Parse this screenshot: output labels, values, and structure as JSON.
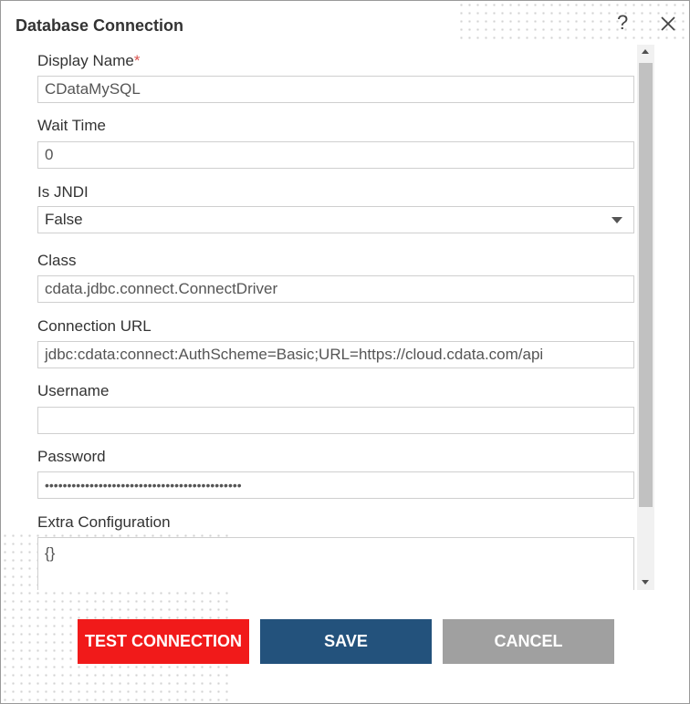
{
  "dialog": {
    "title": "Database Connection",
    "help_icon": "?",
    "close_icon": "close-icon"
  },
  "form": {
    "display_name": {
      "label": "Display Name",
      "required_mark": "*",
      "value": "CDataMySQL"
    },
    "wait_time": {
      "label": "Wait Time",
      "value": "0"
    },
    "is_jndi": {
      "label": "Is JNDI",
      "selected": "False"
    },
    "class": {
      "label": "Class",
      "value": "cdata.jdbc.connect.ConnectDriver"
    },
    "connection_url": {
      "label": "Connection URL",
      "value": "jdbc:cdata:connect:AuthScheme=Basic;URL=https://cloud.cdata.com/api"
    },
    "username": {
      "label": "Username",
      "value": ""
    },
    "password": {
      "label": "Password",
      "value": "••••••••••••••••••••••••••••••••••••••••••••"
    },
    "extra_configuration": {
      "label": "Extra Configuration",
      "value": "{}"
    }
  },
  "buttons": {
    "test_connection": "TEST CONNECTION",
    "save": "SAVE",
    "cancel": "CANCEL"
  },
  "colors": {
    "test_button": "#f11a1a",
    "save_button": "#23527c",
    "cancel_button": "#a0a0a0",
    "required": "#d9534f"
  }
}
